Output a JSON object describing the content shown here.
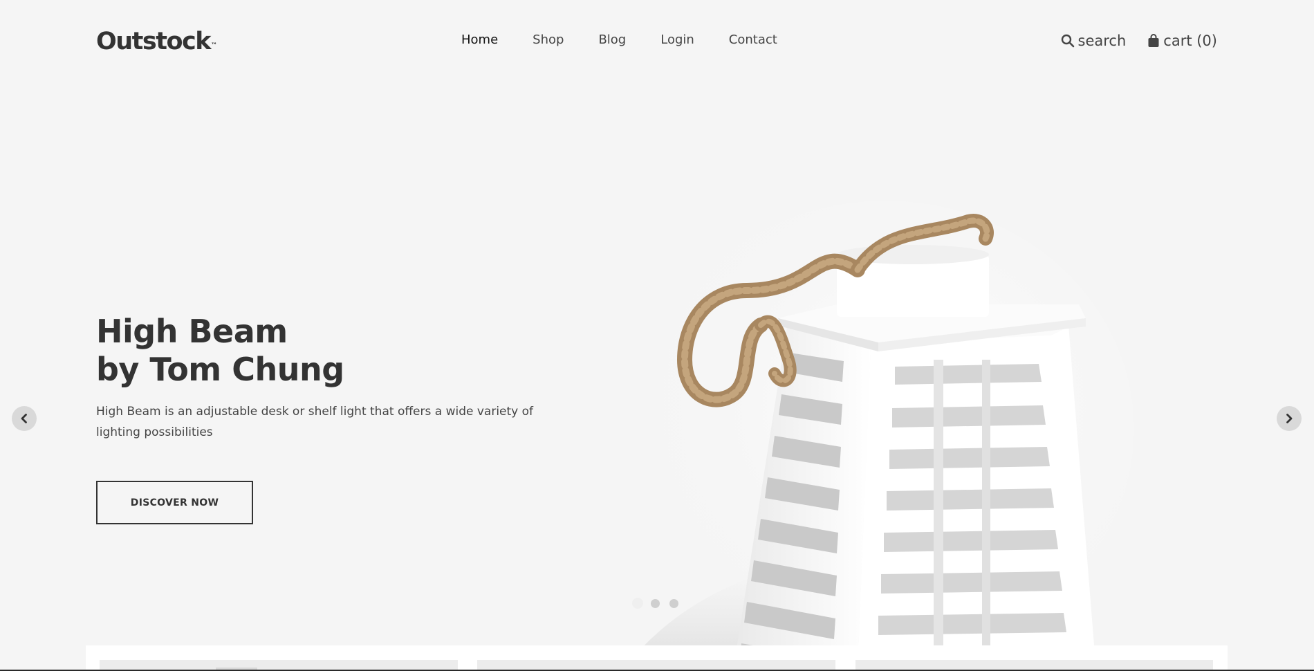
{
  "brand": {
    "logo_text": "Outstock",
    "logo_mark": "™"
  },
  "nav": {
    "items": [
      {
        "label": "Home",
        "active": true
      },
      {
        "label": "Shop",
        "active": false
      },
      {
        "label": "Blog",
        "active": false
      },
      {
        "label": "Login",
        "active": false
      },
      {
        "label": "Contact",
        "active": false
      }
    ]
  },
  "tools": {
    "search_label": "search",
    "search_icon": "search-icon",
    "cart_label": "cart (0)",
    "cart_icon": "shopping-bag-icon"
  },
  "hero": {
    "title_line1": "High Beam",
    "title_line2": "by Tom Chung",
    "description": "High Beam is an adjustable desk or shelf light that offers a wide variety of lighting possibilities",
    "cta_label": "DISCOVER NOW",
    "image": "white wooden lantern with rope handle",
    "slide_count": 3,
    "active_slide": 1,
    "prev_icon": "chevron-left-icon",
    "next_icon": "chevron-right-icon"
  },
  "colors": {
    "background": "#f5f5f5",
    "text": "#333333",
    "button_border": "#333333"
  }
}
